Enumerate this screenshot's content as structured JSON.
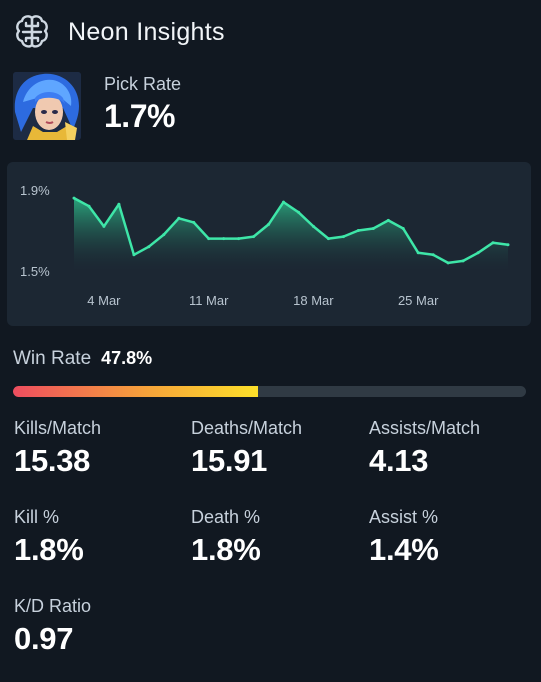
{
  "header": {
    "title": "Neon Insights",
    "icon": "brain-icon"
  },
  "pick_rate": {
    "label": "Pick Rate",
    "value": "1.7%"
  },
  "chart_data": {
    "type": "area",
    "x": [
      "Mar 1",
      "Mar 2",
      "Mar 3",
      "Mar 4",
      "Mar 5",
      "Mar 6",
      "Mar 7",
      "Mar 8",
      "Mar 9",
      "Mar 10",
      "Mar 11",
      "Mar 12",
      "Mar 13",
      "Mar 14",
      "Mar 15",
      "Mar 16",
      "Mar 17",
      "Mar 18",
      "Mar 19",
      "Mar 20",
      "Mar 21",
      "Mar 22",
      "Mar 23",
      "Mar 24",
      "Mar 25",
      "Mar 26",
      "Mar 27",
      "Mar 28",
      "Mar 29",
      "Mar 30",
      "Mar 31"
    ],
    "values": [
      1.86,
      1.82,
      1.72,
      1.83,
      1.58,
      1.62,
      1.68,
      1.76,
      1.74,
      1.66,
      1.66,
      1.66,
      1.67,
      1.73,
      1.84,
      1.79,
      1.72,
      1.66,
      1.67,
      1.7,
      1.71,
      1.75,
      1.71,
      1.59,
      1.58,
      1.54,
      1.55,
      1.59,
      1.64,
      1.63
    ],
    "ylim": [
      1.5,
      1.9
    ],
    "yticks": [
      "1.9%",
      "1.5%"
    ],
    "xticks": [
      {
        "label": "4 Mar",
        "index": 2
      },
      {
        "label": "11 Mar",
        "index": 9
      },
      {
        "label": "18 Mar",
        "index": 16
      },
      {
        "label": "25 Mar",
        "index": 23
      }
    ],
    "title": "",
    "xlabel": "",
    "ylabel": "",
    "line_color": "#3ee6a8"
  },
  "win_rate": {
    "label": "Win Rate",
    "value": "47.8%",
    "fraction": 0.478
  },
  "stats": [
    {
      "label": "Kills/Match",
      "value": "15.38"
    },
    {
      "label": "Deaths/Match",
      "value": "15.91"
    },
    {
      "label": "Assists/Match",
      "value": "4.13"
    },
    {
      "label": "Kill %",
      "value": "1.8%"
    },
    {
      "label": "Death %",
      "value": "1.8%"
    },
    {
      "label": "Assist %",
      "value": "1.4%"
    },
    {
      "label": "K/D Ratio",
      "value": "0.97"
    }
  ]
}
